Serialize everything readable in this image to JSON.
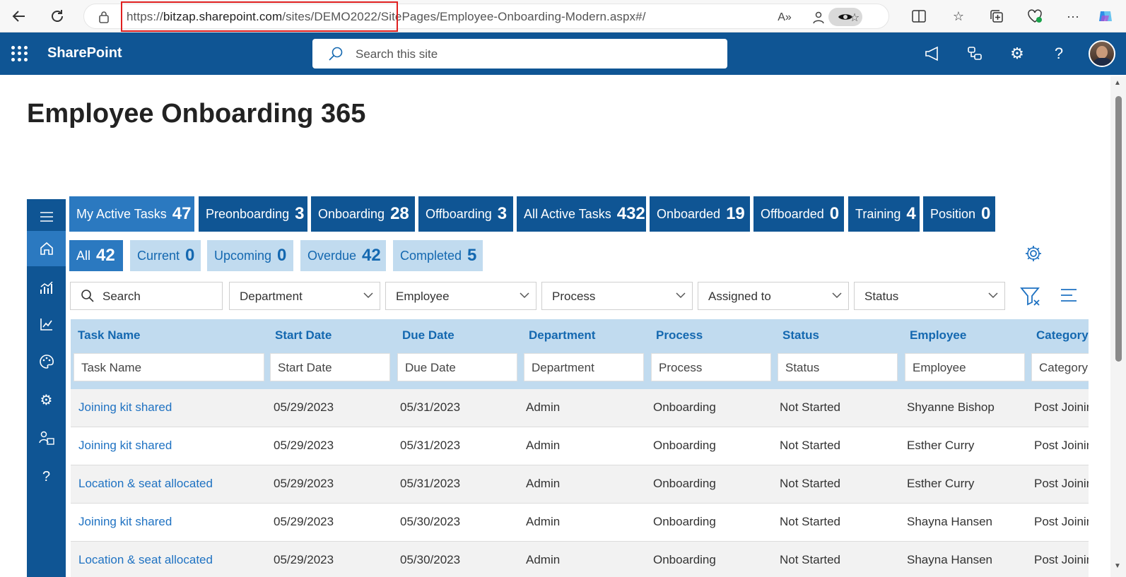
{
  "browser": {
    "url_scheme": "https://",
    "url_host": "bitzap.sharepoint.com",
    "url_path": "/sites/DEMO2022/SitePages/Employee-Onboarding-Modern.aspx#/"
  },
  "suite": {
    "app_name": "SharePoint",
    "search_placeholder": "Search this site"
  },
  "page": {
    "title": "Employee Onboarding 365"
  },
  "tabs": [
    {
      "label": "My Active Tasks",
      "count": "47"
    },
    {
      "label": "Preonboarding",
      "count": "3"
    },
    {
      "label": "Onboarding",
      "count": "28"
    },
    {
      "label": "Offboarding",
      "count": "3"
    },
    {
      "label": "All Active Tasks",
      "count": "432"
    },
    {
      "label": "Onboarded",
      "count": "19"
    },
    {
      "label": "Offboarded",
      "count": "0"
    },
    {
      "label": "Training",
      "count": "4"
    },
    {
      "label": "Position",
      "count": "0"
    }
  ],
  "subtabs": [
    {
      "label": "All",
      "count": "42"
    },
    {
      "label": "Current",
      "count": "0"
    },
    {
      "label": "Upcoming",
      "count": "0"
    },
    {
      "label": "Overdue",
      "count": "42"
    },
    {
      "label": "Completed",
      "count": "5"
    }
  ],
  "filters": {
    "search": "Search",
    "department": "Department",
    "employee": "Employee",
    "process": "Process",
    "assigned_to": "Assigned to",
    "status": "Status"
  },
  "table": {
    "columns": [
      "Task Name",
      "Start Date",
      "Due Date",
      "Department",
      "Process",
      "Status",
      "Employee",
      "Category"
    ],
    "filter_placeholders": [
      "Task Name",
      "Start Date",
      "Due Date",
      "Department",
      "Process",
      "Status",
      "Employee",
      "Category"
    ],
    "rows": [
      [
        "Joining kit shared",
        "05/29/2023",
        "05/31/2023",
        "Admin",
        "Onboarding",
        "Not Started",
        "Shyanne Bishop",
        "Post Joining"
      ],
      [
        "Joining kit shared",
        "05/29/2023",
        "05/31/2023",
        "Admin",
        "Onboarding",
        "Not Started",
        "Esther Curry",
        "Post Joining"
      ],
      [
        "Location & seat allocated",
        "05/29/2023",
        "05/31/2023",
        "Admin",
        "Onboarding",
        "Not Started",
        "Esther Curry",
        "Post Joining"
      ],
      [
        "Joining kit shared",
        "05/29/2023",
        "05/30/2023",
        "Admin",
        "Onboarding",
        "Not Started",
        "Shayna Hansen",
        "Post Joining"
      ],
      [
        "Location & seat allocated",
        "05/29/2023",
        "05/30/2023",
        "Admin",
        "Onboarding",
        "Not Started",
        "Shayna Hansen",
        "Post Joining"
      ]
    ]
  },
  "colors": {
    "primary": "#0f5594",
    "active": "#2b79c0",
    "light": "#c1dbef",
    "link": "#1f72c2"
  }
}
